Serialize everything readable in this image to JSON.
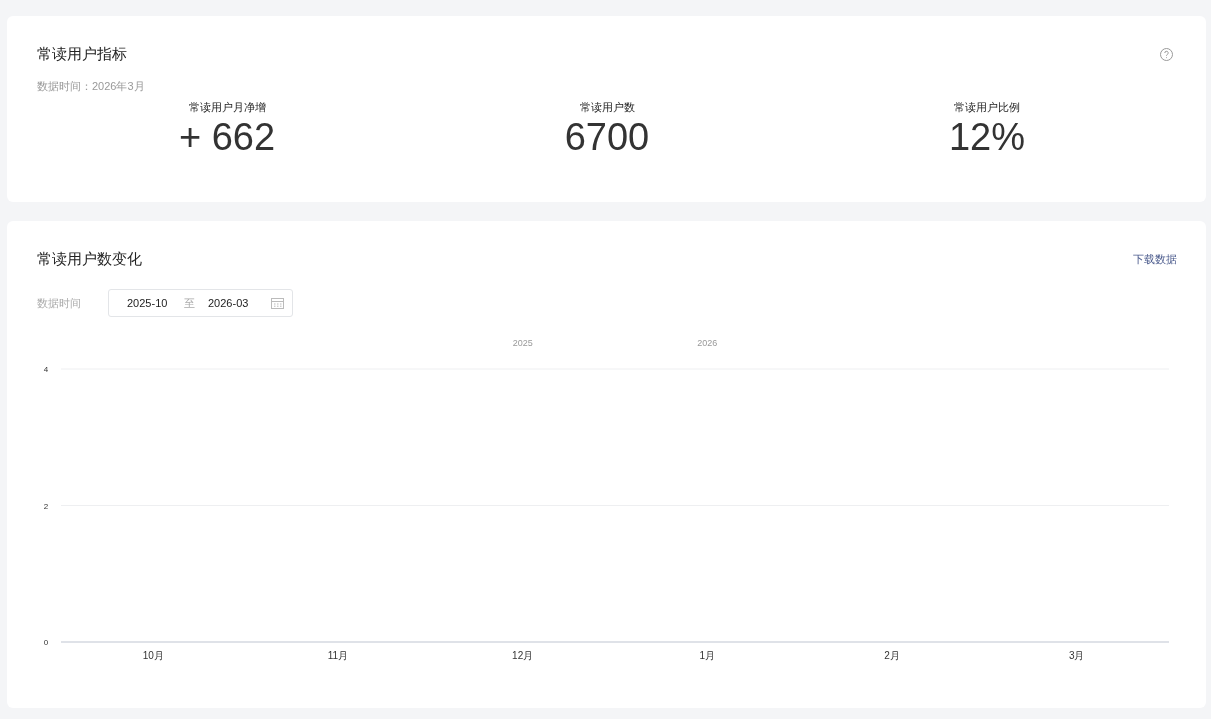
{
  "metrics_card": {
    "title": "常读用户指标",
    "data_time": "数据时间：2026年3月",
    "metrics": [
      {
        "label": "常读用户月净增",
        "value": "+ 662"
      },
      {
        "label": "常读用户数",
        "value": "6700"
      },
      {
        "label": "常读用户比例",
        "value": "12%"
      }
    ]
  },
  "trend_card": {
    "title": "常读用户数变化",
    "download_link": "下载数据",
    "date_label": "数据时间",
    "date_range": {
      "start": "2025-10",
      "separator": "至",
      "end": "2026-03"
    },
    "year_labels": [
      {
        "label": "2025"
      },
      {
        "label": "2026"
      }
    ],
    "chart_data": {
      "type": "line",
      "categories": [
        "10月",
        "11月",
        "12月",
        "1月",
        "2月",
        "3月"
      ],
      "ylim": [
        0,
        4
      ],
      "yticks": [
        0,
        2,
        4
      ]
    }
  }
}
